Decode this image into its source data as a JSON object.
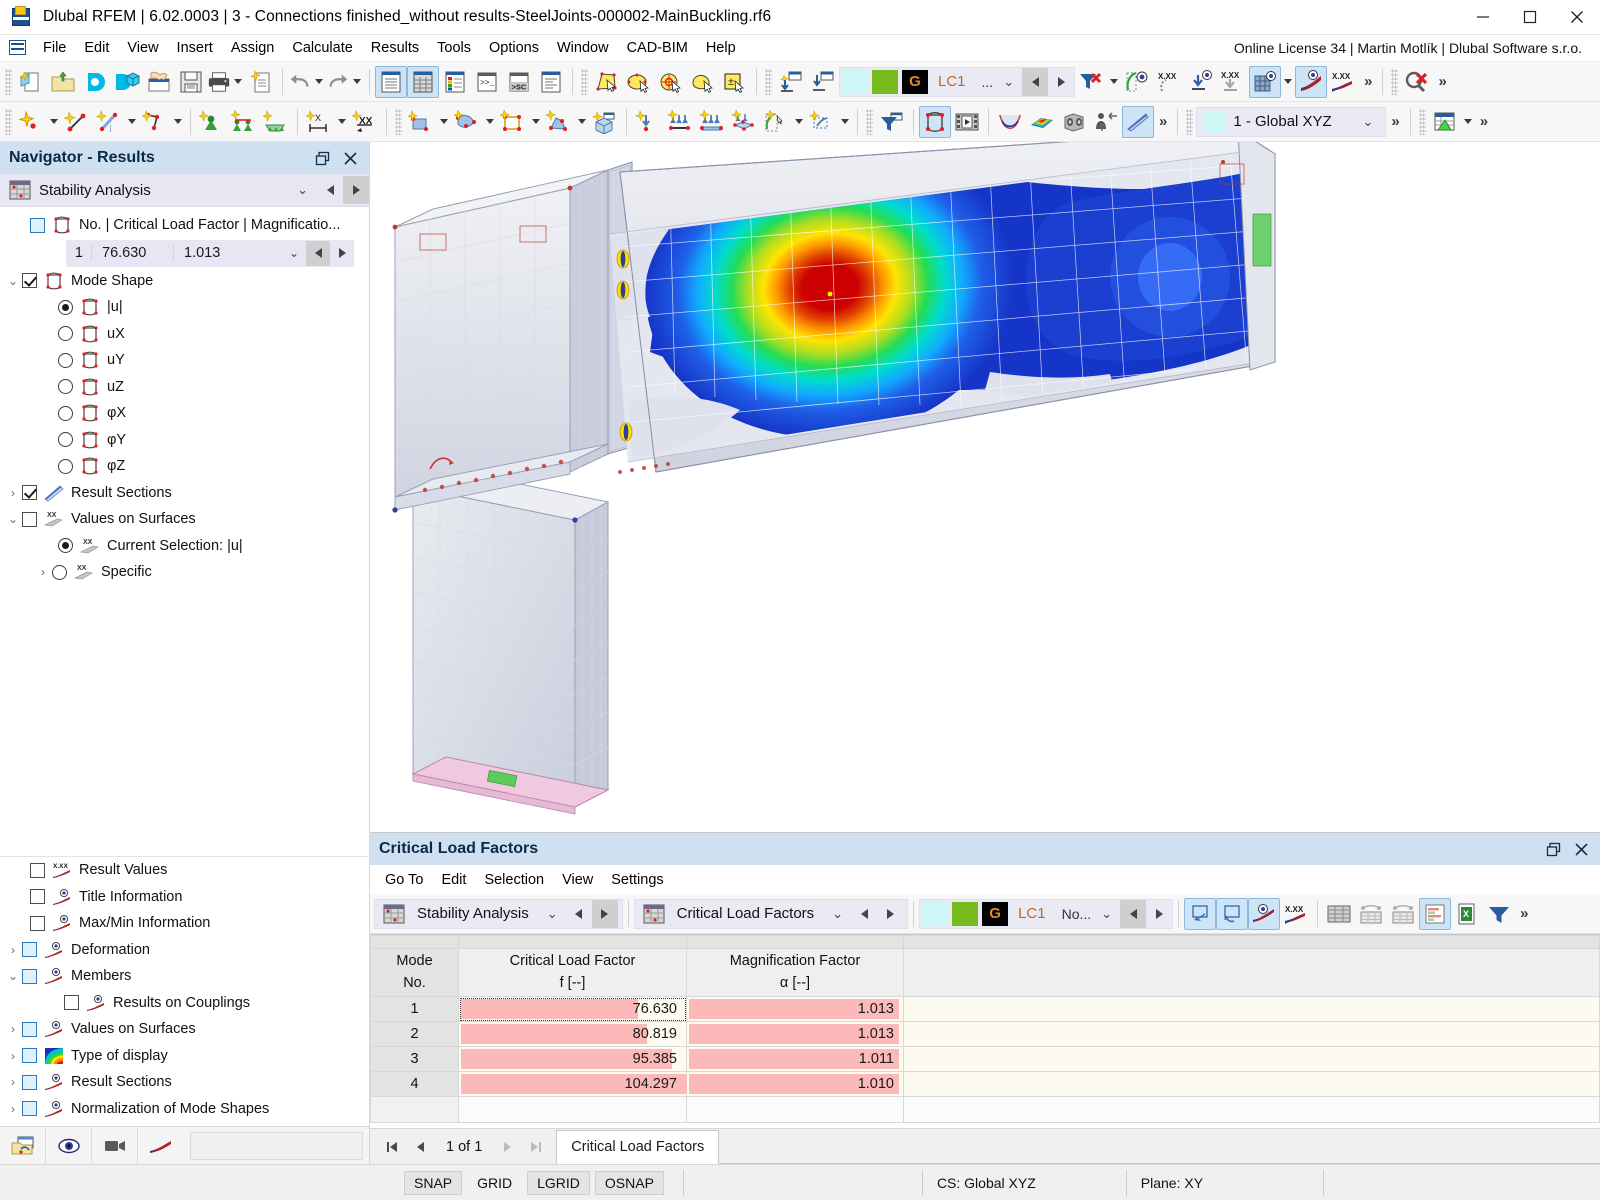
{
  "window": {
    "title": "Dlubal RFEM | 6.02.0003 | 3 - Connections finished_without results-SteelJoints-000002-MainBuckling.rf6",
    "app_icon": "dlubal-rfem-icon",
    "minimize": "minimize-button",
    "maximize": "maximize-button",
    "close": "close-button"
  },
  "menubar": {
    "items": [
      "File",
      "Edit",
      "View",
      "Insert",
      "Assign",
      "Calculate",
      "Results",
      "Tools",
      "Options",
      "Window",
      "CAD-BIM",
      "Help"
    ],
    "license": "Online License 34 | Martin Motlík | Dlubal Software s.r.o."
  },
  "toolbar1": {
    "groups": [
      {
        "icons": [
          "new-model-icon",
          "open-folder-icon",
          "cloud-connect-icon",
          "model-cube-icon",
          "handshake-icon",
          "save-icon",
          "print-icon"
        ]
      },
      {
        "icons": [
          "undo-icon",
          "redo-icon"
        ]
      },
      {
        "icons": [
          "navigator-panel-icon",
          "table-panel-icon",
          "color-panel-icon",
          "console-panel-icon",
          "script-panel-icon",
          "info-panel-icon"
        ]
      },
      {
        "icons": [
          "select-polygon-icon",
          "select-lasso-icon",
          "select-circle-icon",
          "select-freehand-icon",
          "select-add-icon"
        ]
      },
      {
        "icons": [
          "show-objects-icon",
          "hide-objects-icon"
        ]
      },
      {
        "icons": [
          "filter-remove-icon",
          "render-icon",
          "value-eye-icon",
          "deform-eye-icon",
          "load-down-icon",
          "load-gray-icon",
          "grid-eye-icon",
          "diagram-eye-icon",
          "diagram-values-icon"
        ]
      },
      {
        "icons": [
          "delete-results-icon"
        ]
      }
    ],
    "load_case": {
      "swatch_cyan": "#ccf7f7",
      "swatch_green": "#77bc1f",
      "g_label": "G",
      "lc_label": "LC1",
      "dots": "..."
    }
  },
  "toolbar2": {
    "groups": [
      {
        "icons": [
          "new-node-icon",
          "new-line-icon",
          "new-member-icon",
          "new-polyline-icon"
        ]
      },
      {
        "icons": [
          "nodal-support-icon",
          "line-support-icon",
          "surface-support-icon"
        ]
      },
      {
        "icons": [
          "dimension-x-icon",
          "dimension-xx-icon"
        ]
      },
      {
        "icons": [
          "new-surface-icon",
          "new-curved-surface-icon",
          "new-opening-icon",
          "new-solid-icon",
          "new-block-icon"
        ]
      },
      {
        "icons": [
          "nodal-load-icon",
          "member-load-icon",
          "line-load-icon",
          "surface-load-icon",
          "free-load-icon",
          "imperfection-icon"
        ]
      },
      {
        "icons": [
          "filter-window-icon"
        ]
      },
      {
        "icons": [
          "mode-shape-icon",
          "animation-icon"
        ]
      },
      {
        "icons": [
          "deformation-diagram-icon",
          "surface-results-icon",
          "solid-results-icon",
          "extrude-icon",
          "result-section-icon"
        ]
      }
    ],
    "coordinate_system": {
      "swatch": "#ccf7f7",
      "label": "1 - Global XYZ"
    },
    "spreadsheet_icon": "spreadsheet-icon"
  },
  "navigator": {
    "title": "Navigator - Results",
    "undock_icon": "undock-icon",
    "close_icon": "close-icon",
    "combo": {
      "icon": "stability-analysis-icon",
      "label": "Stability Analysis"
    },
    "load_factor_row": {
      "icon": "mode-shape-icon",
      "label": "No. | Critical Load Factor | Magnificatio...",
      "checked": false
    },
    "load_factor_values": {
      "no": "1",
      "factor": "76.630",
      "magnification": "1.013"
    },
    "mode_shape": {
      "label": "Mode Shape",
      "checked": true,
      "expanded": true
    },
    "components": [
      {
        "label": "|u|",
        "selected": true
      },
      {
        "label": "uX",
        "selected": false
      },
      {
        "label": "uY",
        "selected": false
      },
      {
        "label": "uZ",
        "selected": false
      },
      {
        "label": "φX",
        "selected": false
      },
      {
        "label": "φY",
        "selected": false
      },
      {
        "label": "φZ",
        "selected": false
      }
    ],
    "result_sections": {
      "label": "Result Sections",
      "checked": true
    },
    "values_on_surfaces": {
      "label": "Values on Surfaces",
      "checked": false
    },
    "values_options": [
      {
        "label": "Current Selection: |u|",
        "selected": true
      },
      {
        "label": "Specific",
        "selected": false
      }
    ],
    "display_items": [
      {
        "label": "Result Values",
        "icon": "result-values-icon",
        "checkbox": "empty",
        "expander": false
      },
      {
        "label": "Title Information",
        "icon": "title-info-icon",
        "checkbox": "empty",
        "expander": false
      },
      {
        "label": "Max/Min Information",
        "icon": "maxmin-info-icon",
        "checkbox": "empty",
        "expander": false
      },
      {
        "label": "Deformation",
        "icon": "deformation-icon",
        "checkbox": "blue",
        "expander": true
      },
      {
        "label": "Members",
        "icon": "members-icon",
        "checkbox": "blue",
        "expander": true,
        "expanded": true
      },
      {
        "label": "Results on Couplings",
        "icon": "couplings-icon",
        "checkbox": "empty",
        "expander": false,
        "indent": true
      },
      {
        "label": "Values on Surfaces",
        "icon": "values-surfaces-icon",
        "checkbox": "blue",
        "expander": true
      },
      {
        "label": "Type of display",
        "icon": "type-display-icon",
        "checkbox": "blue",
        "expander": true
      },
      {
        "label": "Result Sections",
        "icon": "result-sections-icon",
        "checkbox": "blue",
        "expander": true
      },
      {
        "label": "Normalization of Mode Shapes",
        "icon": "normalization-icon",
        "checkbox": "blue",
        "expander": true
      }
    ],
    "footer_icons": [
      "open-view-icon",
      "visibility-icon",
      "camera-icon",
      "diagram-icon"
    ]
  },
  "table_panel": {
    "title": "Critical Load Factors",
    "undock_icon": "undock-icon",
    "close_icon": "close-icon",
    "menu": [
      "Go To",
      "Edit",
      "Selection",
      "View",
      "Settings"
    ],
    "combo_analysis": {
      "icon": "stability-analysis-icon",
      "label": "Stability Analysis"
    },
    "combo_table": {
      "icon": "critical-load-factors-icon",
      "label": "Critical Load Factors"
    },
    "load_case": {
      "swatch_cyan": "#ccf7f7",
      "swatch_green": "#77bc1f",
      "g_label": "G",
      "lc_label": "LC1",
      "no_label": "No..."
    },
    "toolbar_icons": [
      "select-in-table-icon",
      "select-in-graphic-icon",
      "view-result-icon",
      "values-icon",
      "table-full-icon",
      "table-partial-icon",
      "table-filter-icon",
      "chart-icon",
      "excel-export-icon",
      "filter-icon"
    ],
    "columns": [
      {
        "title": "Mode",
        "subtitle": "No.",
        "unit": ""
      },
      {
        "title": "Critical Load Factor",
        "subtitle": "f [--]",
        "unit": "f [--]"
      },
      {
        "title": "Magnification Factor",
        "subtitle": "α [--]",
        "unit": "α [--]"
      },
      {
        "title": "",
        "subtitle": "",
        "unit": ""
      }
    ],
    "rows": [
      {
        "mode": "1",
        "critical_load_factor": "76.630",
        "magnification_factor": "1.013",
        "selected": true,
        "clf_bar_pct": 78,
        "mag_bar_pct": 97
      },
      {
        "mode": "2",
        "critical_load_factor": "80.819",
        "magnification_factor": "1.013",
        "selected": false,
        "clf_bar_pct": 82,
        "mag_bar_pct": 97
      },
      {
        "mode": "3",
        "critical_load_factor": "95.385",
        "magnification_factor": "1.011",
        "selected": false,
        "clf_bar_pct": 93,
        "mag_bar_pct": 97
      },
      {
        "mode": "4",
        "critical_load_factor": "104.297",
        "magnification_factor": "1.010",
        "selected": false,
        "clf_bar_pct": 100,
        "mag_bar_pct": 97
      }
    ],
    "footer": {
      "page_label": "1 of 1",
      "tab_label": "Critical Load Factors"
    }
  },
  "statusbar": {
    "chips": [
      "SNAP",
      "GRID",
      "LGRID",
      "OSNAP"
    ],
    "coordinate_system": "CS: Global XYZ",
    "plane": "Plane: XY"
  },
  "chart_data": {
    "type": "table",
    "title": "Critical Load Factors",
    "categories": [
      "1",
      "2",
      "3",
      "4"
    ],
    "series": [
      {
        "name": "Critical Load Factor f [--]",
        "values": [
          76.63,
          80.819,
          95.385,
          104.297
        ]
      },
      {
        "name": "Magnification Factor α [--]",
        "values": [
          1.013,
          1.013,
          1.011,
          1.01
        ]
      }
    ],
    "xlabel": "Mode No.",
    "ylabel": ""
  },
  "viewport": {
    "model": "steel-joint-buckling-mode-shape",
    "legend_colors": [
      "#cc0000",
      "#ff6600",
      "#ffee00",
      "#66dd22",
      "#00e0d0",
      "#2299ff",
      "#1133cc"
    ]
  }
}
